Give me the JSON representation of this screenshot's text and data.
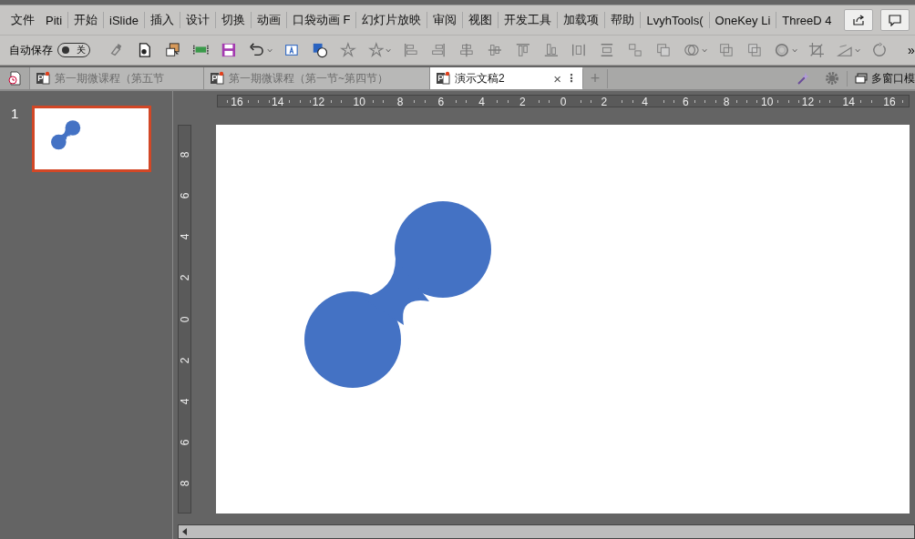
{
  "menu": [
    {
      "label": "文件"
    },
    {
      "label": "Piti"
    },
    {
      "label": "开始"
    },
    {
      "label": "iSlide"
    },
    {
      "label": "插入"
    },
    {
      "label": "设计"
    },
    {
      "label": "切换"
    },
    {
      "label": "动画"
    },
    {
      "label": "口袋动画 F"
    },
    {
      "label": "幻灯片放映"
    },
    {
      "label": "审阅"
    },
    {
      "label": "视图"
    },
    {
      "label": "开发工具"
    },
    {
      "label": "加载项"
    },
    {
      "label": "帮助"
    },
    {
      "label": "LvyhTools("
    },
    {
      "label": "OneKey Li"
    },
    {
      "label": "ThreeD 4"
    }
  ],
  "autosave": {
    "label": "自动保存",
    "on": false,
    "state_text": "关"
  },
  "overflow": "»",
  "doc_tabs": [
    {
      "title": "第一期微课程（第五节",
      "selected": false
    },
    {
      "title": "第一期微课程（第一节~第四节）",
      "selected": false
    },
    {
      "title": "演示文稿2",
      "selected": true
    }
  ],
  "close_glyph": "×",
  "more_glyph": "⋮",
  "add_tab": "+",
  "multi_window": "多窗口模",
  "slides": [
    {
      "number": "1",
      "selected": true
    }
  ],
  "h_ruler": [
    "16",
    "14",
    "12",
    "10",
    "8",
    "6",
    "4",
    "2",
    "0",
    "2",
    "4",
    "6",
    "8",
    "10",
    "12",
    "14",
    "16"
  ],
  "v_ruler": [
    "8",
    "6",
    "4",
    "2",
    "0",
    "2",
    "4",
    "6",
    "8"
  ]
}
